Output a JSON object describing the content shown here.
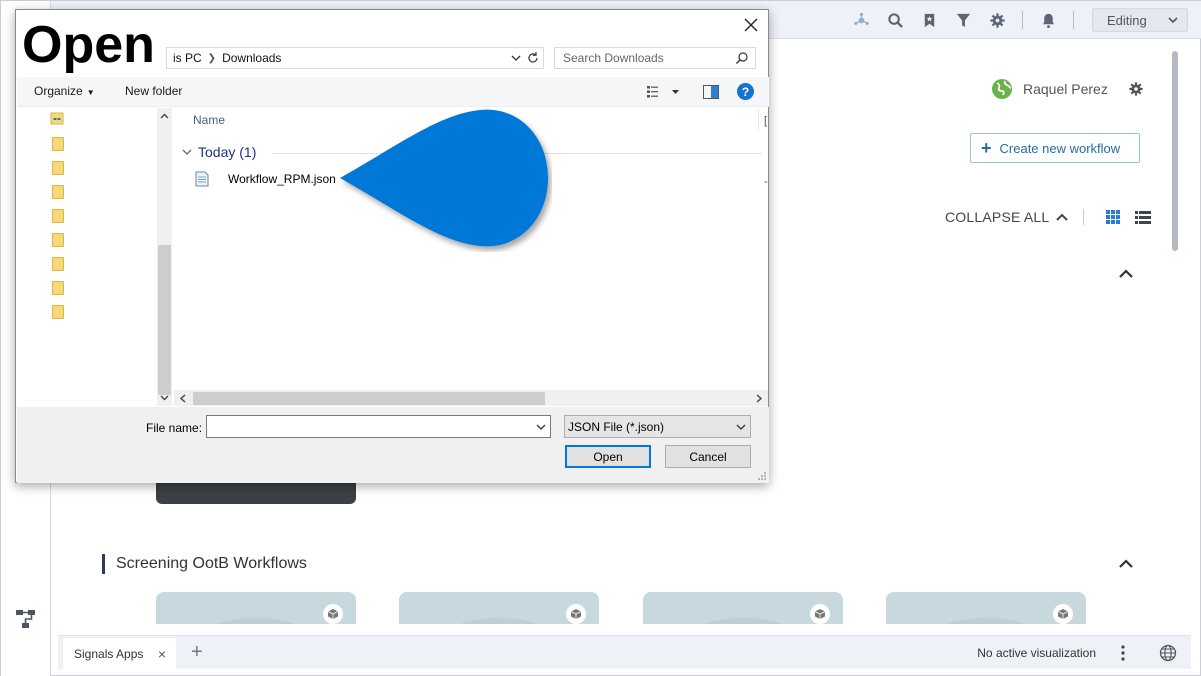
{
  "app": {
    "mode_select": "Editing",
    "user_name": "Raquel Perez",
    "create_workflow_label": "Create new workflow",
    "collapse_all_label": "COLLAPSE ALL",
    "section_title": "Screening OotB Workflows",
    "bottom_tab_label": "Signals Apps",
    "bottom_tab_close": "×",
    "add_tab_label": "+",
    "viz_status": "No active visualization",
    "accent_color": "#1f6fa3",
    "icons": [
      "network-icon",
      "search-icon",
      "bookmark-icon",
      "filter-icon",
      "gear-icon",
      "bell-icon",
      "globe-icon",
      "grid-view-icon",
      "list-view-icon",
      "workflow-icon"
    ]
  },
  "dialog": {
    "title": "Open",
    "breadcrumb": [
      "is PC",
      "Downloads"
    ],
    "search_placeholder": "Search Downloads",
    "toolbar": {
      "organize_label": "Organize",
      "new_folder_label": "New folder",
      "help_label": "?"
    },
    "column_name": "Name",
    "group_label": "Today (1)",
    "files": [
      {
        "name": "Workflow_RPM.json"
      }
    ],
    "file_name_label": "File name:",
    "file_name_value": "",
    "filter_value": "JSON File (*.json)",
    "open_label": "Open",
    "cancel_label": "Cancel",
    "pointer_color": "#0078d7"
  }
}
